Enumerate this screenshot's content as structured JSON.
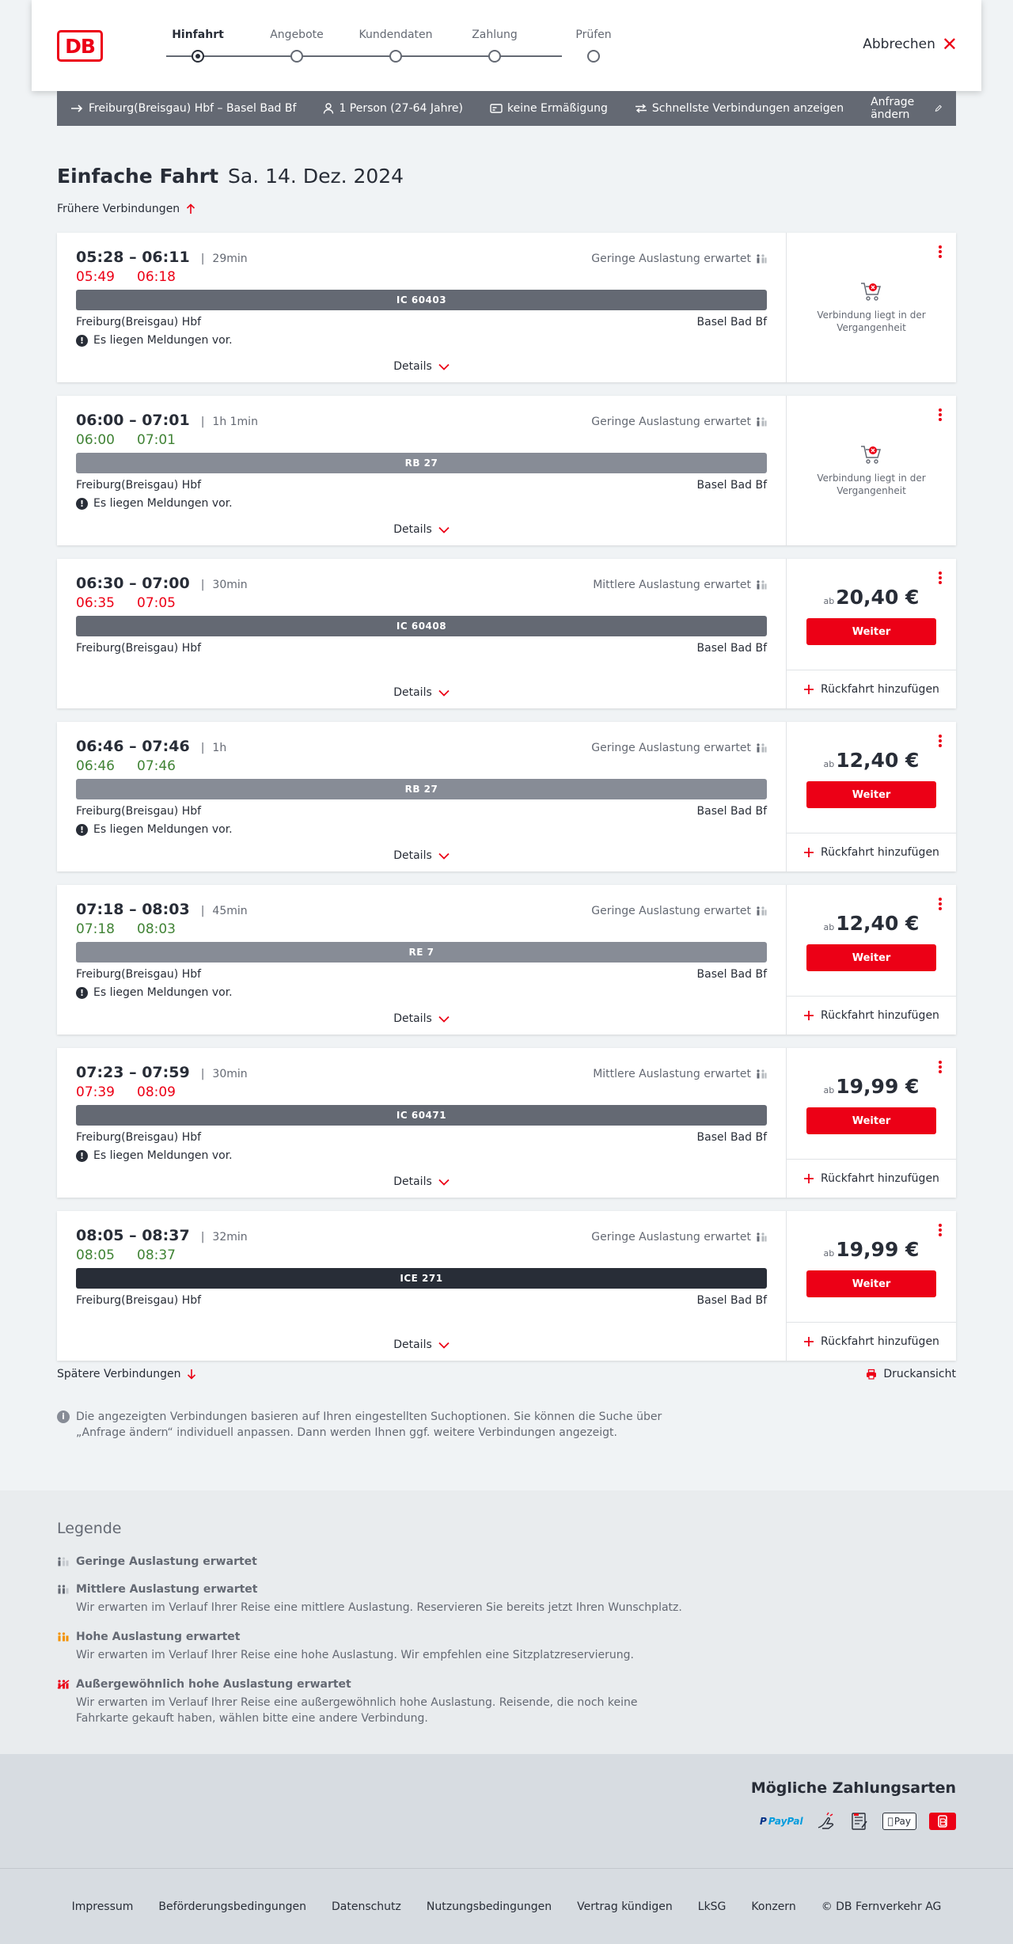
{
  "header": {
    "logo": "DB",
    "steps": [
      "Hinfahrt",
      "Angebote",
      "Kundendaten",
      "Zahlung",
      "Prüfen"
    ],
    "active_step": 0,
    "cancel_label": "Abbrechen"
  },
  "summary": {
    "route": "Freiburg(Breisgau) Hbf – Basel Bad Bf",
    "passengers": "1 Person (27-64 Jahre)",
    "discount": "keine Ermäßigung",
    "option": "Schnellste Verbindungen anzeigen",
    "change_label": "Anfrage ändern"
  },
  "main": {
    "title": "Einfache Fahrt",
    "date": "Sa. 14. Dez. 2024",
    "earlier_label": "Frühere Verbindungen",
    "later_label": "Spätere Verbindungen",
    "print_label": "Druckansicht",
    "info_text": "Die angezeigten Verbindungen basieren auf Ihren eingestellten Suchoptionen. Sie können die Suche über „Anfrage ändern“ individuell anpassen. Dann werden Ihnen ggf. weitere Verbindungen angezeigt."
  },
  "card_common": {
    "details_label": "Details",
    "notice_text": "Es liegen Meldungen vor.",
    "past_text": "Verbindung liegt in der Vergangenheit",
    "price_prefix": "ab",
    "button_label": "Weiter",
    "return_label": "Rückfahrt hinzufügen"
  },
  "connections": [
    {
      "times": "05:28 – 06:11",
      "duration": "29min",
      "occupancy": "Geringe Auslastung erwartet",
      "rt_dep": "05:49",
      "rt_arr": "06:18",
      "rt_status": "late",
      "train": "IC 60403",
      "train_type": "ic",
      "from": "Freiburg(Breisgau) Hbf",
      "to": "Basel Bad Bf",
      "notice": true,
      "past": true,
      "price": ""
    },
    {
      "times": "06:00 – 07:01",
      "duration": "1h 1min",
      "occupancy": "Geringe Auslastung erwartet",
      "rt_dep": "06:00",
      "rt_arr": "07:01",
      "rt_status": "ok",
      "train": "RB 27",
      "train_type": "rb",
      "from": "Freiburg(Breisgau) Hbf",
      "to": "Basel Bad Bf",
      "notice": true,
      "past": true,
      "price": ""
    },
    {
      "times": "06:30 – 07:00",
      "duration": "30min",
      "occupancy": "Mittlere Auslastung erwartet",
      "rt_dep": "06:35",
      "rt_arr": "07:05",
      "rt_status": "late",
      "train": "IC 60408",
      "train_type": "ic",
      "from": "Freiburg(Breisgau) Hbf",
      "to": "Basel Bad Bf",
      "notice": false,
      "past": false,
      "price": "20,40 €"
    },
    {
      "times": "06:46 – 07:46",
      "duration": "1h",
      "occupancy": "Geringe Auslastung erwartet",
      "rt_dep": "06:46",
      "rt_arr": "07:46",
      "rt_status": "ok",
      "train": "RB 27",
      "train_type": "rb",
      "from": "Freiburg(Breisgau) Hbf",
      "to": "Basel Bad Bf",
      "notice": true,
      "past": false,
      "price": "12,40 €"
    },
    {
      "times": "07:18 – 08:03",
      "duration": "45min",
      "occupancy": "Geringe Auslastung erwartet",
      "rt_dep": "07:18",
      "rt_arr": "08:03",
      "rt_status": "ok",
      "train": "RE 7",
      "train_type": "rb",
      "from": "Freiburg(Breisgau) Hbf",
      "to": "Basel Bad Bf",
      "notice": true,
      "past": false,
      "price": "12,40 €"
    },
    {
      "times": "07:23 – 07:59",
      "duration": "30min",
      "occupancy": "Mittlere Auslastung erwartet",
      "rt_dep": "07:39",
      "rt_arr": "08:09",
      "rt_status": "late",
      "train": "IC 60471",
      "train_type": "ic",
      "from": "Freiburg(Breisgau) Hbf",
      "to": "Basel Bad Bf",
      "notice": true,
      "past": false,
      "price": "19,99 €"
    },
    {
      "times": "08:05 – 08:37",
      "duration": "32min",
      "occupancy": "Geringe Auslastung erwartet",
      "rt_dep": "08:05",
      "rt_arr": "08:37",
      "rt_status": "ok",
      "train": "ICE 271",
      "train_type": "ice",
      "from": "Freiburg(Breisgau) Hbf",
      "to": "Basel Bad Bf",
      "notice": false,
      "past": false,
      "price": "19,99 €"
    }
  ],
  "legend": {
    "title": "Legende",
    "items": [
      {
        "label": "Geringe Auslastung erwartet",
        "desc": ""
      },
      {
        "label": "Mittlere Auslastung erwartet",
        "desc": "Wir erwarten im Verlauf Ihrer Reise eine mittlere Auslastung. Reservieren Sie bereits jetzt Ihren Wunschplatz."
      },
      {
        "label": "Hohe Auslastung erwartet",
        "desc": "Wir erwarten im Verlauf Ihrer Reise eine hohe Auslastung. Wir empfehlen eine Sitzplatzreservierung."
      },
      {
        "label": "Außergewöhnlich hohe Auslastung erwartet",
        "desc": "Wir erwarten im Verlauf Ihrer Reise eine außergewöhnlich hohe Auslastung. Reisende, die noch keine Fahrkarte gekauft haben, wählen bitte eine andere Verbindung."
      }
    ]
  },
  "payments": {
    "title": "Mögliche Zahlungsarten",
    "methods": [
      "paypal-icon",
      "sepa-hand-icon",
      "invoice-icon",
      "apple-pay-icon",
      "db-bonus-icon"
    ],
    "paypal_text": "PayPal",
    "applepay_text": "Pay"
  },
  "footer": {
    "links": [
      "Impressum",
      "Beförderungsbedingungen",
      "Datenschutz",
      "Nutzungsbedingungen",
      "Vertrag kündigen",
      "LkSG",
      "Konzern",
      "© DB Fernverkehr AG"
    ]
  },
  "colors": {
    "brand_red": "#ec0016",
    "delay_red": "#ec0016",
    "ontime_green": "#408335",
    "bar_grey": "#646973"
  }
}
